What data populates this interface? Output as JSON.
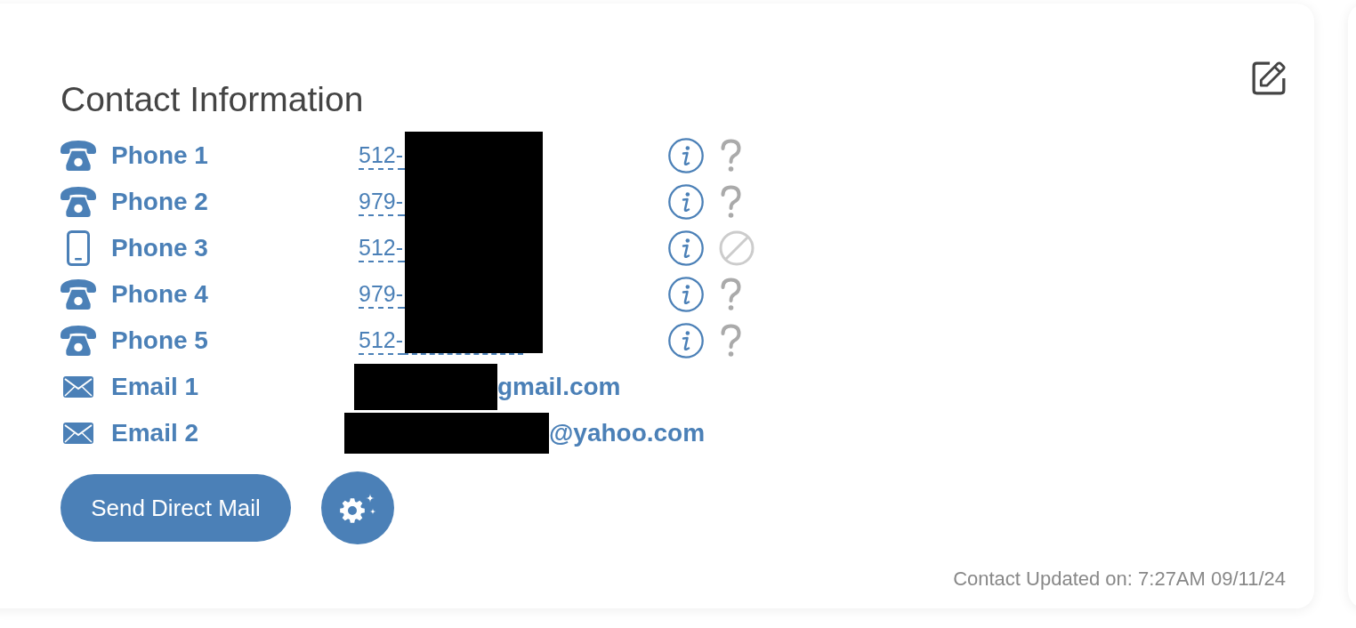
{
  "card": {
    "title": "Contact Information"
  },
  "phones": {
    "redacted": true,
    "items": [
      {
        "kind": "landline",
        "label": "Phone 1",
        "number": "512-",
        "blocked": false
      },
      {
        "kind": "landline",
        "label": "Phone 2",
        "number": "979-",
        "blocked": false
      },
      {
        "kind": "mobile",
        "label": "Phone 3",
        "number": "512-",
        "blocked": true
      },
      {
        "kind": "landline",
        "label": "Phone 4",
        "number": "979-",
        "blocked": false
      },
      {
        "kind": "landline",
        "label": "Phone 5",
        "number": "512-",
        "blocked": false
      }
    ]
  },
  "emails": [
    {
      "label": "Email 1",
      "value": "gmail.com",
      "redacted": true
    },
    {
      "label": "Email 2",
      "value": "@yahoo.com",
      "redacted": true
    }
  ],
  "actions": {
    "primary": "Send Direct Mail"
  },
  "footer": "Contact Updated on: 7:27AM 09/11/24"
}
